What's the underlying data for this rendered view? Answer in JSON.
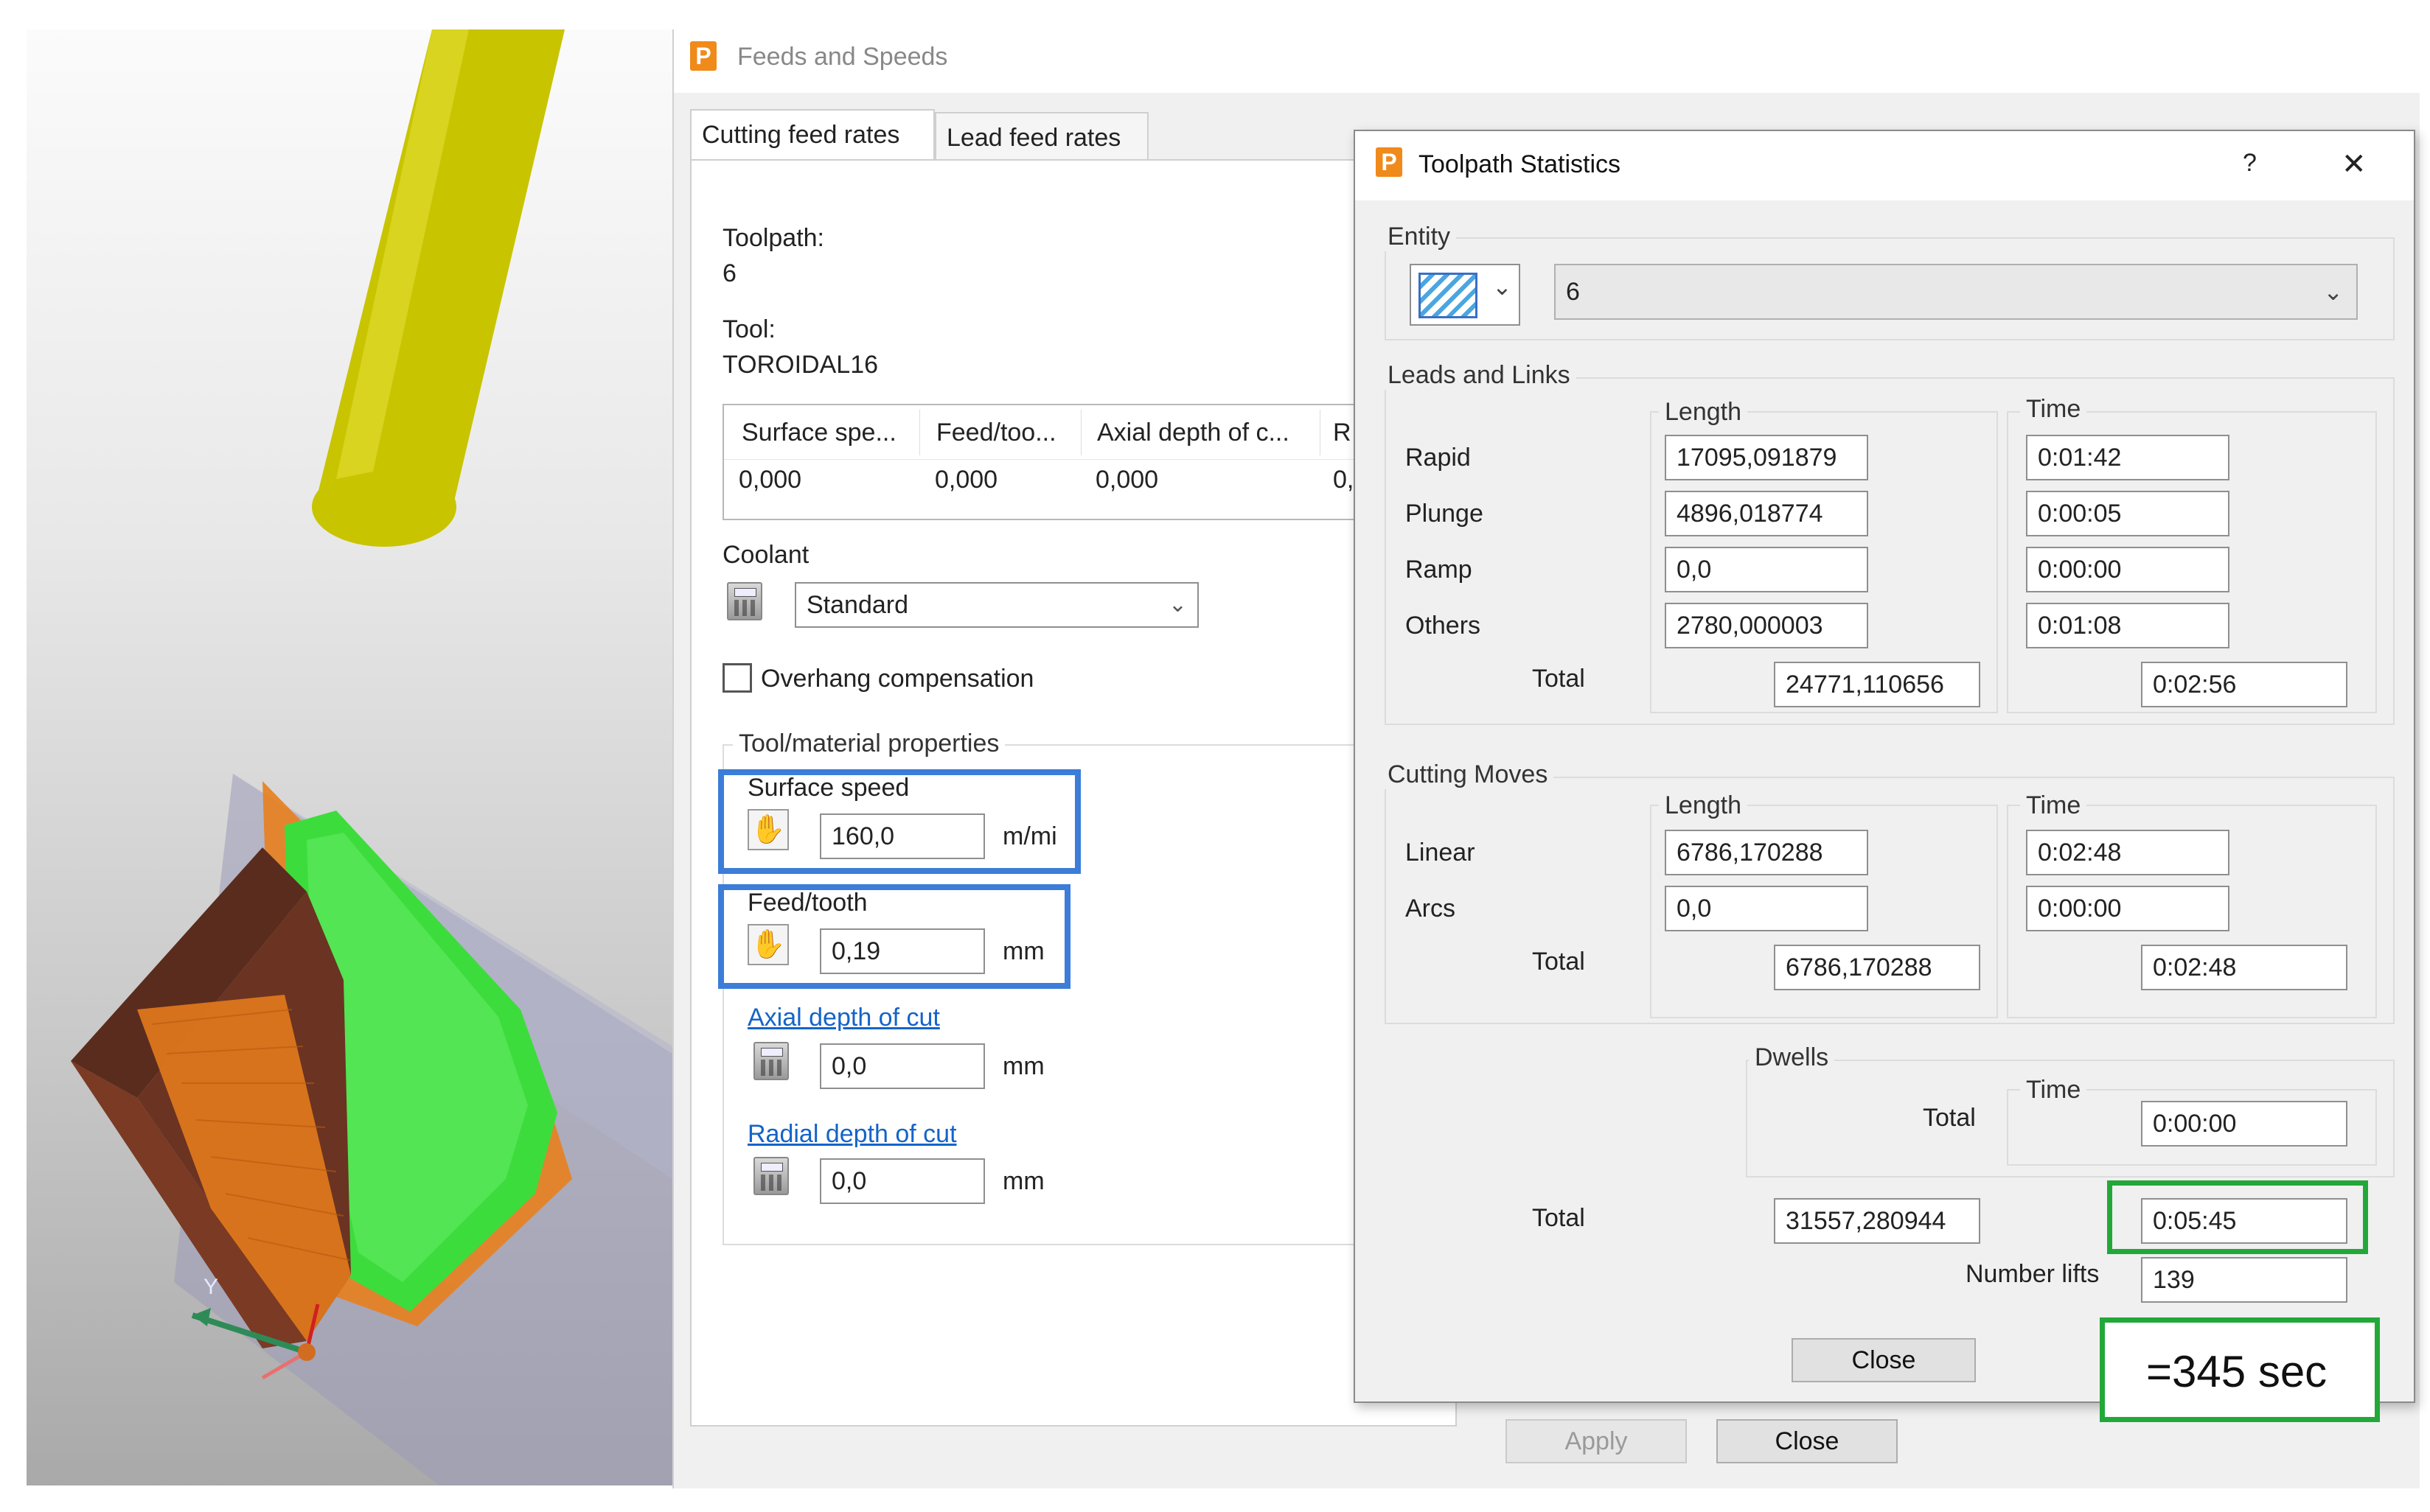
{
  "feeds_window": {
    "title": "Feeds and Speeds",
    "tabs": [
      "Cutting feed rates",
      "Lead feed rates"
    ],
    "toolpath_label": "Toolpath:",
    "toolpath_value": "6",
    "tool_label": "Tool:",
    "tool_value": "TOROIDAL16",
    "table": {
      "headers": [
        "Surface spe...",
        "Feed/too...",
        "Axial depth of c...",
        "R"
      ],
      "values": [
        "0,000",
        "0,000",
        "0,000",
        "0,"
      ]
    },
    "coolant_label": "Coolant",
    "coolant_value": "Standard",
    "overhang_label": "Overhang compensation",
    "properties_title": "Tool/material properties",
    "surface_speed": {
      "label": "Surface speed",
      "value": "160,0",
      "unit": "m/mi"
    },
    "feed_tooth": {
      "label": "Feed/tooth",
      "value": "0,19",
      "unit": "mm"
    },
    "axial_depth": {
      "label": "Axial depth of cut",
      "value": "0,0",
      "unit": "mm"
    },
    "radial_depth": {
      "label": "Radial depth of cut",
      "value": "0,0",
      "unit": "mm"
    },
    "apply_label": "Apply",
    "close_label": "Close"
  },
  "stats_dialog": {
    "title": "Toolpath Statistics",
    "help": "?",
    "close_x": "✕",
    "entity_title": "Entity",
    "entity_value": "6",
    "leads": {
      "title": "Leads and Links",
      "length_header": "Length",
      "time_header": "Time",
      "rows": [
        {
          "label": "Rapid",
          "length": "17095,091879",
          "time": "0:01:42"
        },
        {
          "label": "Plunge",
          "length": "4896,018774",
          "time": "0:00:05"
        },
        {
          "label": "Ramp",
          "length": "0,0",
          "time": "0:00:00"
        },
        {
          "label": "Others",
          "length": "2780,000003",
          "time": "0:01:08"
        }
      ],
      "total_label": "Total",
      "total_length": "24771,110656",
      "total_time": "0:02:56"
    },
    "cutting": {
      "title": "Cutting Moves",
      "length_header": "Length",
      "time_header": "Time",
      "rows": [
        {
          "label": "Linear",
          "length": "6786,170288",
          "time": "0:02:48"
        },
        {
          "label": "Arcs",
          "length": "0,0",
          "time": "0:00:00"
        }
      ],
      "total_label": "Total",
      "total_length": "6786,170288",
      "total_time": "0:02:48"
    },
    "dwells": {
      "title": "Dwells",
      "time_header": "Time",
      "total_label": "Total",
      "total_time": "0:00:00"
    },
    "grand_total_label": "Total",
    "grand_total_length": "31557,280944",
    "grand_total_time": "0:05:45",
    "lifts_label": "Number lifts",
    "lifts_value": "139",
    "close_label": "Close"
  },
  "annotation": "=345 sec",
  "viewport": {
    "axis_y_label": "Y"
  },
  "colors": {
    "tool_yellow": "#c8c400",
    "toolpath_green": "#3ddc3d",
    "toolpath_orange": "#e8801e",
    "stock_brown": "#6b3322",
    "highlight_blue": "#3b7dd8",
    "highlight_green": "#22a838"
  }
}
